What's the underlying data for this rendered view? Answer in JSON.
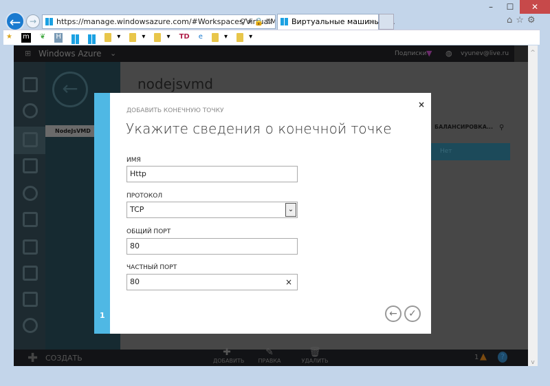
{
  "browser": {
    "url": "https://manage.windowsazure.com/#Workspaces/VirtualMachi",
    "tab_title": "Виртуальные машины - ...",
    "window_controls": [
      "minimize",
      "maximize",
      "close"
    ]
  },
  "favorites": {
    "items": [
      "m",
      "H",
      "TD"
    ]
  },
  "portal": {
    "brand": "Windows Azure",
    "subscriptions": "Подписки",
    "user": "vyunev@live.ru",
    "vm_name": "nodejsvmd",
    "vm_list_item": "NodeJsVMD",
    "column_header": "БАЛАНСИРОВКА...",
    "row_value": "Нет"
  },
  "bottombar": {
    "create": "СОЗДАТЬ",
    "add": "ДОБАВИТЬ",
    "edit": "ПРАВКА",
    "delete": "УДАЛИТЬ",
    "alerts": "1",
    "help": "?"
  },
  "dialog": {
    "step_label": "ДОБАВИТЬ КОНЕЧНУЮ ТОЧКУ",
    "title": "Укажите сведения о конечной точке",
    "step_number": "1",
    "fields": {
      "name_label": "ИМЯ",
      "name_value": "Http",
      "protocol_label": "ПРОТОКОЛ",
      "protocol_value": "TCP",
      "public_port_label": "ОБЩИЙ ПОРТ",
      "public_port_value": "80",
      "private_port_label": "ЧАСТНЫЙ ПОРТ",
      "private_port_value": "80"
    }
  }
}
